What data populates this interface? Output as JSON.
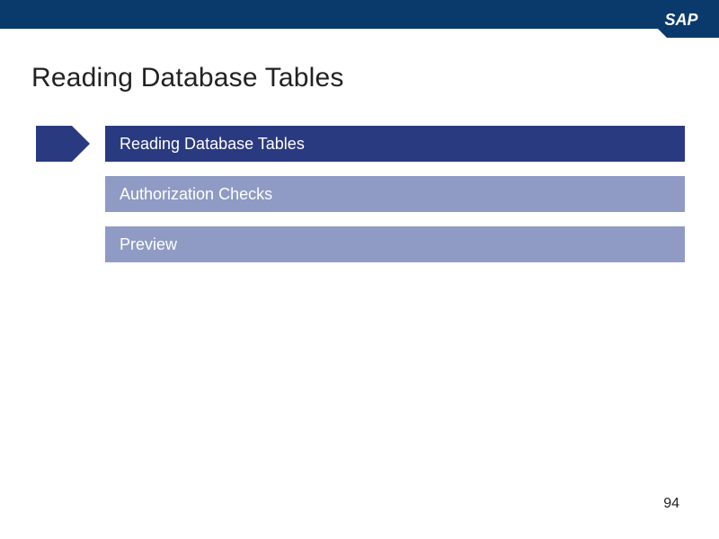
{
  "header": {
    "logo_text": "SAP"
  },
  "page": {
    "title": "Reading Database Tables",
    "number": "94"
  },
  "agenda": {
    "items": [
      {
        "label": "Reading Database Tables",
        "active": true
      },
      {
        "label": "Authorization Checks",
        "active": false
      },
      {
        "label": "Preview",
        "active": false
      }
    ]
  },
  "colors": {
    "topbar": "#0a3a6b",
    "bar_active": "#2a3a80",
    "bar_inactive": "#8f9bc4"
  }
}
